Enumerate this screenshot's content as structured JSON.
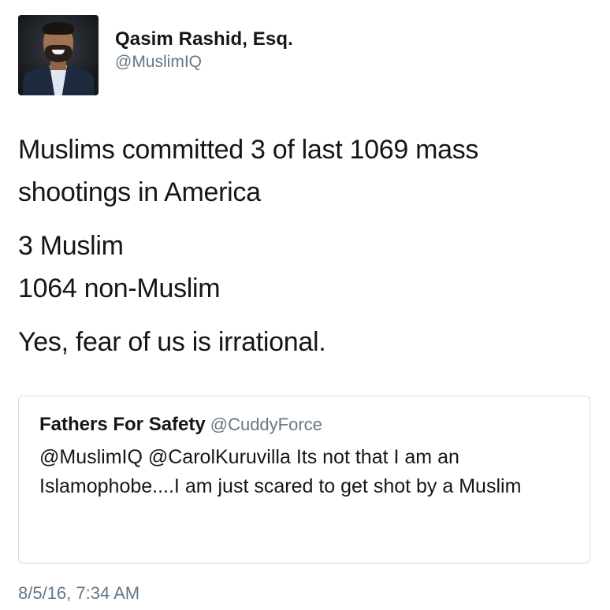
{
  "author": {
    "display_name": "Qasim Rashid, Esq.",
    "handle": "@MuslimIQ",
    "avatar_icon": "profile-photo-icon"
  },
  "tweet": {
    "lines": [
      "Muslims committed 3 of last 1069 mass shootings in America",
      "3 Muslim",
      "1064 non-Muslim",
      "Yes, fear of us is irrational."
    ],
    "timestamp": "8/5/16, 7:34 AM"
  },
  "quoted_tweet": {
    "display_name": "Fathers For Safety",
    "handle": "@CuddyForce",
    "text": "@MuslimIQ @CarolKuruvilla Its not that I am an Islamophobe....I am just scared to get shot by a Muslim"
  },
  "colors": {
    "text_primary": "#14171a",
    "text_secondary": "#657786",
    "border": "#d8dde2"
  }
}
